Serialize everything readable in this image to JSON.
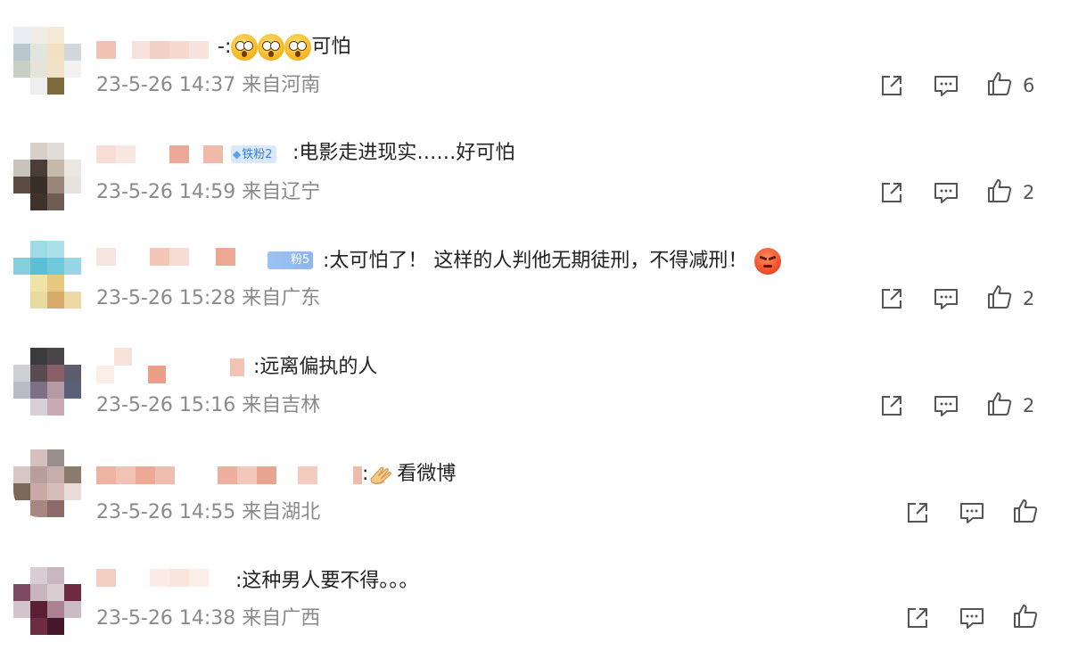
{
  "comments": [
    {
      "text": "-:",
      "text_after": "可怕",
      "emojis": [
        "scared",
        "scared",
        "scared"
      ],
      "badge": "",
      "date": "23-5-26",
      "time": "14:37",
      "location": "来自河南",
      "likes": "6"
    },
    {
      "text": ":电影走进现实……好可怕",
      "badge": "铁粉2",
      "date": "23-5-26",
      "time": "14:59",
      "location": "来自辽宁",
      "likes": "2"
    },
    {
      "text": ":太可怕了！ 这样的人判他无期徒刑，不得减刑！",
      "emojis": [
        "angry"
      ],
      "badge": "粉5",
      "date": "23-5-26",
      "time": "15:28",
      "location": "来自广东",
      "likes": "2"
    },
    {
      "text": ":远离偏执的人",
      "badge": "",
      "date": "23-5-26",
      "time": "15:16",
      "location": "来自吉林",
      "likes": "2"
    },
    {
      "text": ":",
      "text_after": "看微博",
      "emojis": [
        "clap"
      ],
      "badge": "",
      "date": "23-5-26",
      "time": "14:55",
      "location": "来自湖北",
      "likes": ""
    },
    {
      "text": ":这种男人要不得。。。",
      "badge": "",
      "date": "23-5-26",
      "time": "14:38",
      "location": "来自广西",
      "likes": ""
    }
  ],
  "icons": {
    "repost": "repost-icon",
    "comment": "comment-icon",
    "like": "thumbs-up-icon"
  },
  "colors": {
    "text": "#222222",
    "meta": "#8a8a8a",
    "icon": "#555555",
    "badge_bg": "#d9e9fb",
    "badge_text": "#3f7fd6"
  }
}
